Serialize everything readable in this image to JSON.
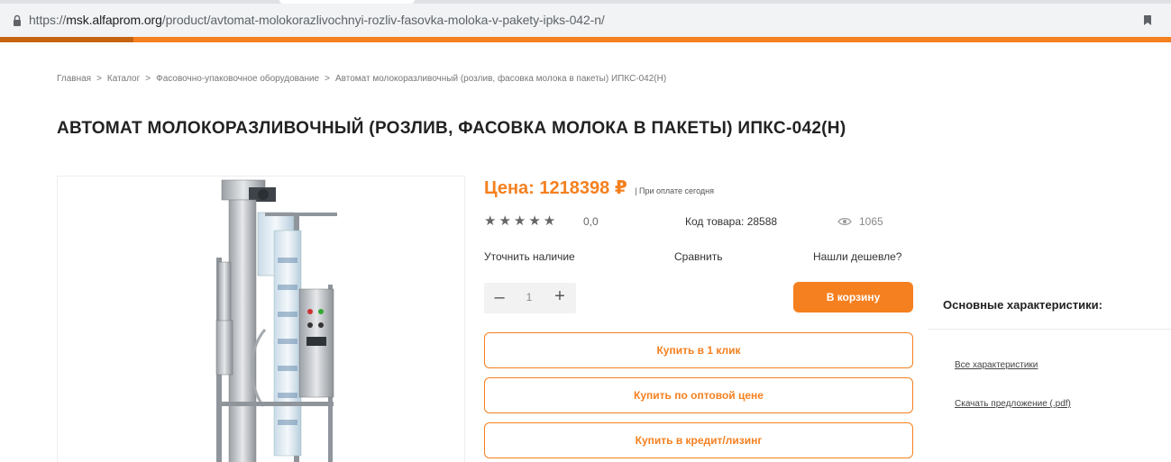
{
  "browser": {
    "url_prefix": "https://",
    "url_host": "msk.alfaprom.org",
    "url_path": "/product/avtomat-molokorazlivochnyi-rozliv-fasovka-moloka-v-pakety-ipks-042-n/"
  },
  "breadcrumb": [
    "Главная",
    "Каталог",
    "Фасовочно-упаковочное оборудование",
    "Автомат молокоразливочный (розлив, фасовка молока в пакеты) ИПКС-042(Н)"
  ],
  "breadcrumb_separator": ">",
  "product": {
    "title": "АВТОМАТ МОЛОКОРАЗЛИВОЧНЫЙ (РОЗЛИВ, ФАСОВКА МОЛОКА В ПАКЕТЫ) ИПКС-042(Н)",
    "price": "Цена: 1218398 ₽",
    "price_note": "| При оплате сегодня",
    "stars": "★★★★★",
    "rating": "0,0",
    "sku": "Код товара: 28588",
    "views": "1065",
    "quantity": "1"
  },
  "actions": {
    "check_availability": "Уточнить наличие",
    "compare": "Сравнить",
    "found_cheaper": "Нашли дешевле?",
    "add_to_cart": "В корзину",
    "buy_one_click": "Купить в 1 клик",
    "buy_wholesale": "Купить по оптовой цене",
    "buy_credit": "Купить в кредит/лизинг",
    "qty_minus": "–",
    "qty_plus": "+"
  },
  "characteristics": {
    "title": "Основные характеристики:",
    "all_link": "Все характеристики",
    "download_link": "Скачать предложение (.pdf)"
  },
  "colors": {
    "accent": "#f5801f",
    "accent_dark": "#c76410"
  },
  "icons": {
    "lock": "lock-icon",
    "bookmark": "bookmark-icon",
    "eye": "eye-icon"
  }
}
